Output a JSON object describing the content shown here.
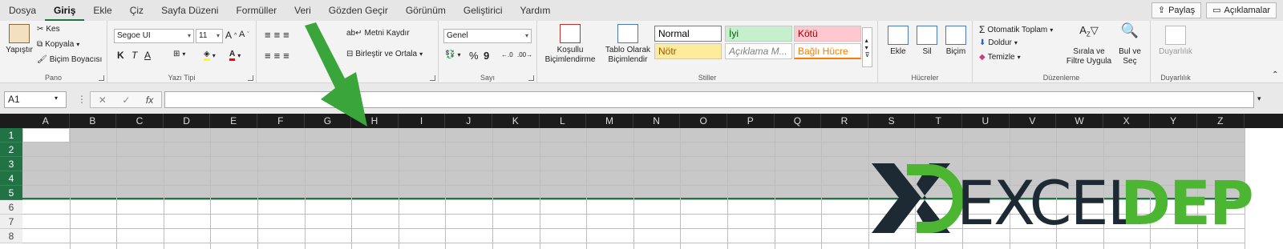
{
  "tabs": [
    "Dosya",
    "Giriş",
    "Ekle",
    "Çiz",
    "Sayfa Düzeni",
    "Formüller",
    "Veri",
    "Gözden Geçir",
    "Görünüm",
    "Geliştirici",
    "Yardım"
  ],
  "active_tab": "Giriş",
  "share_label": "Paylaş",
  "comments_label": "Açıklamalar",
  "clipboard": {
    "paste": "Yapıştır",
    "cut": "Kes",
    "copy": "Kopyala",
    "format_painter": "Biçim Boyacısı",
    "label": "Pano"
  },
  "font": {
    "name": "Segoe UI",
    "size": "11",
    "bold": "K",
    "italic": "T",
    "underline": "A",
    "label": "Yazı Tipi"
  },
  "alignment": {
    "wrap": "Metni Kaydır",
    "merge": "Birleştir ve Ortala",
    "label": "Hizalama"
  },
  "number": {
    "format": "Genel",
    "percent": "%",
    "comma": "9",
    "label": "Sayı"
  },
  "styles": {
    "conditional": "Koşullu Biçimlendirme",
    "as_table": "Tablo Olarak Biçimlendir",
    "cells": [
      {
        "text": "Normal",
        "bg": "#ffffff",
        "color": "#000000"
      },
      {
        "text": "İyi",
        "bg": "#c6efce",
        "color": "#006100"
      },
      {
        "text": "Kötü",
        "bg": "#ffc7ce",
        "color": "#9c0006"
      },
      {
        "text": "Nötr",
        "bg": "#ffeb9c",
        "color": "#9c5700"
      },
      {
        "text": "Açıklama M...",
        "bg": "#ffffff",
        "color": "#7f7f7f"
      },
      {
        "text": "Bağlı Hücre",
        "bg": "#ffffff",
        "color": "#fa7d00"
      }
    ],
    "label": "Stiller"
  },
  "cells_group": {
    "insert": "Ekle",
    "delete": "Sil",
    "format": "Biçim",
    "label": "Hücreler"
  },
  "editing": {
    "autosum": "Otomatik Toplam",
    "fill": "Doldur",
    "clear": "Temizle",
    "sort": "Sırala ve Filtre Uygula",
    "find": "Bul ve Seç",
    "label": "Düzenleme"
  },
  "sensitivity": {
    "button": "Duyarlılık",
    "label": "Duyarlılık"
  },
  "namebox": "A1",
  "fx": "fx",
  "columns": [
    "A",
    "B",
    "C",
    "D",
    "E",
    "F",
    "G",
    "H",
    "I",
    "J",
    "K",
    "L",
    "M",
    "N",
    "O",
    "P",
    "Q",
    "R",
    "S",
    "T",
    "U",
    "V",
    "W",
    "X",
    "Y",
    "Z"
  ],
  "rows": [
    "1",
    "2",
    "3",
    "4",
    "5",
    "6",
    "7",
    "8"
  ],
  "logo": {
    "left": "EXCEL",
    "right": "DEPO"
  },
  "colors": {
    "accent": "#217346",
    "arrow": "#3aa53a",
    "logo_dark": "#1e2a33",
    "logo_green": "#4cb531"
  }
}
